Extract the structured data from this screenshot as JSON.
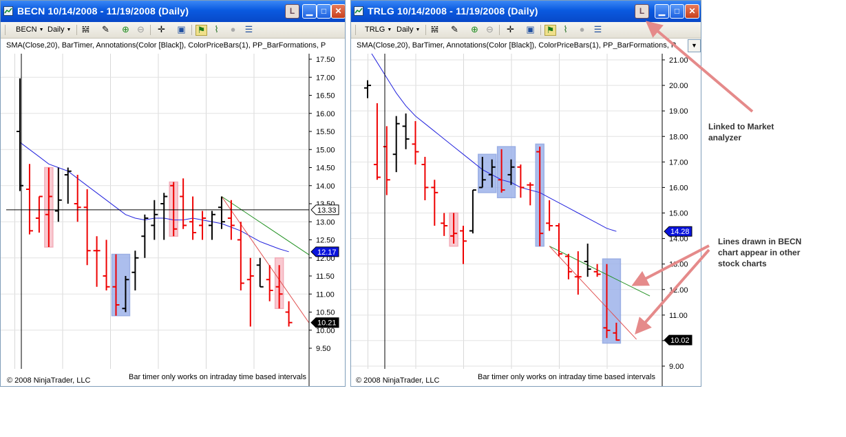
{
  "windows": [
    {
      "id": "becn",
      "title": "BECN  10/14/2008 - 11/19/2008 (Daily)",
      "link_button": "L",
      "toolbar": {
        "symbol": "BECN",
        "interval": "Daily"
      },
      "indicators_line": "SMA(Close,20), BarTimer, Annotations(Color [Black]), ColorPriceBars(1), PP_BarFormations, P",
      "copyright": "© 2008 NinjaTrader, LLC",
      "bar_timer_message": "Bar timer only works on intraday time based intervals",
      "price_axis": {
        "min": 9.5,
        "max": 17.5,
        "step": 0.5,
        "labels": [
          "17.50",
          "17.00",
          "16.50",
          "16.00",
          "15.50",
          "15.00",
          "14.50",
          "14.00",
          "13.50",
          "13.00",
          "12.50",
          "12.00",
          "11.50",
          "11.00",
          "10.50",
          "10.00",
          "9.50"
        ]
      },
      "price_markers": [
        {
          "value": 13.33,
          "label": "13.33",
          "style": "crosshair"
        },
        {
          "value": 12.17,
          "label": "12.17",
          "style": "sma"
        },
        {
          "value": 10.21,
          "label": "10.21",
          "style": "last"
        }
      ]
    },
    {
      "id": "trlg",
      "title": "TRLG  10/14/2008 - 11/19/2008 (Daily)",
      "link_button": "L",
      "toolbar": {
        "symbol": "TRLG",
        "interval": "Daily"
      },
      "indicators_line": "SMA(Close,20), BarTimer, Annotations(Color [Black]), ColorPriceBars(1), PP_BarFormations, P",
      "copyright": "© 2008 NinjaTrader, LLC",
      "bar_timer_message": "Bar timer only works on intraday time based intervals",
      "price_axis": {
        "min": 9.0,
        "max": 21.0,
        "step": 1.0,
        "labels": [
          "21.00",
          "20.00",
          "19.00",
          "18.00",
          "17.00",
          "16.00",
          "15.00",
          "14.00",
          "13.00",
          "12.00",
          "11.00",
          "10.00",
          "9.00"
        ]
      },
      "price_markers": [
        {
          "value": 14.28,
          "label": "14.28",
          "style": "sma"
        },
        {
          "value": 10.02,
          "label": "10.02",
          "style": "last"
        }
      ]
    }
  ],
  "annotations": {
    "linked": [
      "Linked to Market",
      "analyzer"
    ],
    "lines": [
      "Lines drawn in BECN",
      "chart appear in other",
      "stock charts"
    ]
  },
  "colors": {
    "down_bar": "#ee0000",
    "up_bar": "#000000",
    "sma": "#2222dd",
    "trend_green": "#209020",
    "trend_red": "#e05050",
    "highlight_pink": "#f9c0c8",
    "highlight_blue": "#9eb3ea",
    "arrow": "#e58a8a",
    "marker_blue": "#0a14dc"
  },
  "chart_data": [
    {
      "type": "ohlc",
      "symbol": "BECN",
      "bars": [
        {
          "o": 15.5,
          "h": 16.97,
          "l": 13.85,
          "c": 14.0,
          "color": "up"
        },
        {
          "o": 13.9,
          "h": 14.6,
          "l": 12.65,
          "c": 12.75,
          "color": "down"
        },
        {
          "o": 13.1,
          "h": 13.7,
          "l": 12.7,
          "c": 13.7,
          "color": "down"
        },
        {
          "o": 13.2,
          "h": 14.5,
          "l": 12.3,
          "c": 13.7,
          "color": "down"
        },
        {
          "o": 13.3,
          "h": 14.5,
          "l": 13.0,
          "c": 13.6,
          "color": "up"
        },
        {
          "o": 14.3,
          "h": 14.5,
          "l": 13.5,
          "c": 14.4,
          "color": "up"
        },
        {
          "o": 13.5,
          "h": 14.3,
          "l": 13.0,
          "c": 13.4,
          "color": "down"
        },
        {
          "o": 13.4,
          "h": 13.9,
          "l": 11.8,
          "c": 12.2,
          "color": "down"
        },
        {
          "o": 12.2,
          "h": 12.6,
          "l": 11.2,
          "c": 12.2,
          "color": "down"
        },
        {
          "o": 11.5,
          "h": 12.5,
          "l": 11.1,
          "c": 11.2,
          "color": "down"
        },
        {
          "o": 11.2,
          "h": 12.1,
          "l": 10.4,
          "c": 10.7,
          "color": "down"
        },
        {
          "o": 10.6,
          "h": 11.5,
          "l": 10.5,
          "c": 11.4,
          "color": "up"
        },
        {
          "o": 11.6,
          "h": 12.2,
          "l": 11.1,
          "c": 12.0,
          "color": "up"
        },
        {
          "o": 12.6,
          "h": 13.2,
          "l": 12.0,
          "c": 13.1,
          "color": "up"
        },
        {
          "o": 12.9,
          "h": 13.6,
          "l": 12.5,
          "c": 13.2,
          "color": "up"
        },
        {
          "o": 13.5,
          "h": 13.8,
          "l": 12.5,
          "c": 13.7,
          "color": "up"
        },
        {
          "o": 14.0,
          "h": 14.1,
          "l": 12.6,
          "c": 12.8,
          "color": "down"
        },
        {
          "o": 13.7,
          "h": 14.2,
          "l": 12.8,
          "c": 12.9,
          "color": "down"
        },
        {
          "o": 13.0,
          "h": 13.7,
          "l": 12.5,
          "c": 12.7,
          "color": "down"
        },
        {
          "o": 12.9,
          "h": 13.3,
          "l": 12.5,
          "c": 13.1,
          "color": "down"
        },
        {
          "o": 12.9,
          "h": 13.3,
          "l": 12.5,
          "c": 13.2,
          "color": "up"
        },
        {
          "o": 13.4,
          "h": 13.7,
          "l": 12.8,
          "c": 13.0,
          "color": "up"
        },
        {
          "o": 13.1,
          "h": 13.6,
          "l": 12.5,
          "c": 12.9,
          "color": "down"
        },
        {
          "o": 12.5,
          "h": 13.0,
          "l": 11.1,
          "c": 11.3,
          "color": "down"
        },
        {
          "o": 11.4,
          "h": 12.0,
          "l": 10.1,
          "c": 11.5,
          "color": "down"
        },
        {
          "o": 11.8,
          "h": 12.0,
          "l": 11.2,
          "c": 11.2,
          "color": "up"
        },
        {
          "o": 11.4,
          "h": 11.8,
          "l": 10.8,
          "c": 11.1,
          "color": "down"
        },
        {
          "o": 11.2,
          "h": 11.8,
          "l": 10.6,
          "c": 11.0,
          "color": "down"
        },
        {
          "o": 10.5,
          "h": 10.8,
          "l": 10.1,
          "c": 10.21,
          "color": "down"
        }
      ],
      "sma": [
        15.2,
        15.0,
        14.8,
        14.6,
        14.5,
        14.4,
        14.2,
        14.0,
        13.8,
        13.6,
        13.4,
        13.2,
        13.1,
        13.05,
        13.1,
        13.1,
        13.05,
        13.05,
        13.1,
        13.05,
        13.0,
        12.95,
        12.85,
        12.75,
        12.6,
        12.45,
        12.35,
        12.25,
        12.17
      ],
      "highlights": [
        {
          "from": 3,
          "to": 3,
          "low": 12.3,
          "high": 14.5,
          "color": "pink"
        },
        {
          "from": 10,
          "to": 11,
          "low": 10.4,
          "high": 12.1,
          "color": "blue"
        },
        {
          "from": 16,
          "to": 16,
          "low": 12.6,
          "high": 14.1,
          "color": "pink"
        },
        {
          "from": 27,
          "to": 27,
          "low": 10.6,
          "high": 12.0,
          "color": "pink"
        }
      ],
      "trend_lines": [
        {
          "from": {
            "bar": 21,
            "price": 13.7
          },
          "to": {
            "bar": 32,
            "price": 11.75
          },
          "color": "green"
        },
        {
          "from": {
            "bar": 21,
            "price": 13.7
          },
          "to": {
            "bar": 30.5,
            "price": 10.05
          },
          "color": "red"
        }
      ]
    },
    {
      "type": "ohlc",
      "symbol": "TRLG",
      "bars": [
        {
          "o": 19.9,
          "h": 20.2,
          "l": 19.5,
          "c": 20.0,
          "color": "up"
        },
        {
          "o": 16.9,
          "h": 19.3,
          "l": 16.3,
          "c": 16.4,
          "color": "down"
        },
        {
          "o": 17.6,
          "h": 18.4,
          "l": 15.7,
          "c": 16.3,
          "color": "down"
        },
        {
          "o": 17.3,
          "h": 18.8,
          "l": 16.6,
          "c": 18.5,
          "color": "up"
        },
        {
          "o": 18.4,
          "h": 18.9,
          "l": 17.5,
          "c": 17.9,
          "color": "up"
        },
        {
          "o": 17.7,
          "h": 18.6,
          "l": 16.9,
          "c": 17.4,
          "color": "down"
        },
        {
          "o": 16.9,
          "h": 17.2,
          "l": 15.5,
          "c": 16.0,
          "color": "down"
        },
        {
          "o": 16.0,
          "h": 16.3,
          "l": 14.5,
          "c": 15.8,
          "color": "down"
        },
        {
          "o": 14.6,
          "h": 15.0,
          "l": 14.1,
          "c": 14.5,
          "color": "down"
        },
        {
          "o": 14.1,
          "h": 15.0,
          "l": 13.8,
          "c": 14.2,
          "color": "down"
        },
        {
          "o": 14.3,
          "h": 14.5,
          "l": 13.0,
          "c": 13.9,
          "color": "down"
        },
        {
          "o": 14.3,
          "h": 15.9,
          "l": 14.2,
          "c": 15.9,
          "color": "up"
        },
        {
          "o": 16.0,
          "h": 17.2,
          "l": 16.0,
          "c": 16.3,
          "color": "up"
        },
        {
          "o": 16.5,
          "h": 17.1,
          "l": 16.0,
          "c": 16.8,
          "color": "up"
        },
        {
          "o": 16.3,
          "h": 17.5,
          "l": 15.8,
          "c": 15.9,
          "color": "down"
        },
        {
          "o": 16.5,
          "h": 17.1,
          "l": 16.1,
          "c": 16.8,
          "color": "up"
        },
        {
          "o": 16.8,
          "h": 16.9,
          "l": 15.6,
          "c": 16.0,
          "color": "down"
        },
        {
          "o": 16.1,
          "h": 16.2,
          "l": 15.3,
          "c": 16.1,
          "color": "down"
        },
        {
          "o": 17.4,
          "h": 17.6,
          "l": 13.7,
          "c": 14.2,
          "color": "down"
        },
        {
          "o": 14.6,
          "h": 15.5,
          "l": 14.3,
          "c": 14.5,
          "color": "down"
        },
        {
          "o": 14.5,
          "h": 14.6,
          "l": 13.3,
          "c": 13.4,
          "color": "down"
        },
        {
          "o": 13.3,
          "h": 13.4,
          "l": 12.4,
          "c": 12.7,
          "color": "down"
        },
        {
          "o": 12.5,
          "h": 13.5,
          "l": 11.8,
          "c": 12.5,
          "color": "down"
        },
        {
          "o": 13.1,
          "h": 13.8,
          "l": 12.5,
          "c": 12.8,
          "color": "up"
        },
        {
          "o": 12.7,
          "h": 13.0,
          "l": 12.5,
          "c": 12.6,
          "color": "down"
        },
        {
          "o": 10.5,
          "h": 13.0,
          "l": 10.1,
          "c": 10.4,
          "color": "down"
        },
        {
          "o": 10.3,
          "h": 10.7,
          "l": 10.0,
          "c": 10.02,
          "color": "down"
        }
      ],
      "sma": [
        21.5,
        20.9,
        20.3,
        19.7,
        19.2,
        18.8,
        18.5,
        18.2,
        17.9,
        17.6,
        17.3,
        17.0,
        16.7,
        16.5,
        16.3,
        16.2,
        16.0,
        15.9,
        15.8,
        15.6,
        15.4,
        15.2,
        15.0,
        14.8,
        14.6,
        14.4,
        14.28
      ],
      "highlights": [
        {
          "from": 9,
          "to": 9,
          "low": 13.7,
          "high": 15.0,
          "color": "pink"
        },
        {
          "from": 12,
          "to": 13,
          "low": 15.8,
          "high": 17.3,
          "color": "blue"
        },
        {
          "from": 14,
          "to": 15,
          "low": 15.6,
          "high": 17.6,
          "color": "blue"
        },
        {
          "from": 18,
          "to": 18,
          "low": 13.7,
          "high": 17.7,
          "color": "blue"
        },
        {
          "from": 25,
          "to": 26,
          "low": 9.9,
          "high": 13.2,
          "color": "blue"
        }
      ],
      "trend_lines": [
        {
          "from": {
            "bar": 19,
            "price": 13.7
          },
          "to": {
            "bar": 29.5,
            "price": 11.75
          },
          "color": "green"
        },
        {
          "from": {
            "bar": 19,
            "price": 13.7
          },
          "to": {
            "bar": 28.1,
            "price": 10.05
          },
          "color": "red"
        }
      ]
    }
  ]
}
